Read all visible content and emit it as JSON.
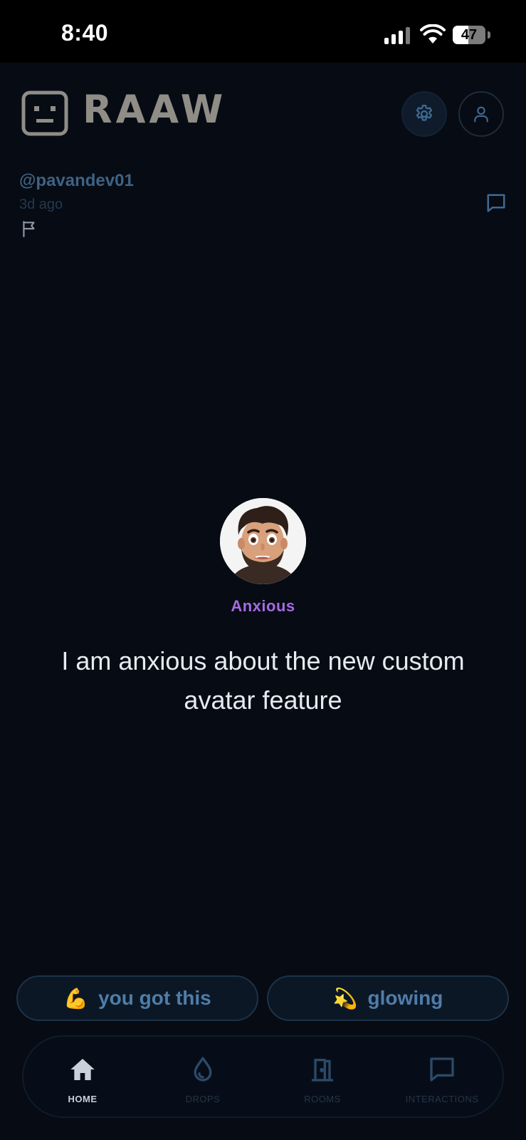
{
  "status_bar": {
    "time": "8:40",
    "battery": "47",
    "battery_level": 0.47
  },
  "header": {
    "app_name": "RAAW"
  },
  "post": {
    "username": "@pavandev01",
    "time_ago": "3d ago",
    "mood": "Anxious",
    "text": "I am anxious about the new custom avatar feature"
  },
  "reactions": [
    {
      "emoji": "💪",
      "label": "you got this"
    },
    {
      "emoji": "💫",
      "label": "glowing"
    }
  ],
  "nav": [
    {
      "label": "HOME",
      "icon": "home-icon",
      "active": true
    },
    {
      "label": "DROPS",
      "icon": "drop-icon",
      "active": false
    },
    {
      "label": "ROOMS",
      "icon": "door-icon",
      "active": false
    },
    {
      "label": "INTERACTIONS",
      "icon": "chat-icon",
      "active": false
    }
  ],
  "colors": {
    "background": "#060b14",
    "mood_accent": "#a66be0",
    "username": "#3f6283",
    "reaction_text": "#4f7da8",
    "logo": "#8f8d86"
  }
}
